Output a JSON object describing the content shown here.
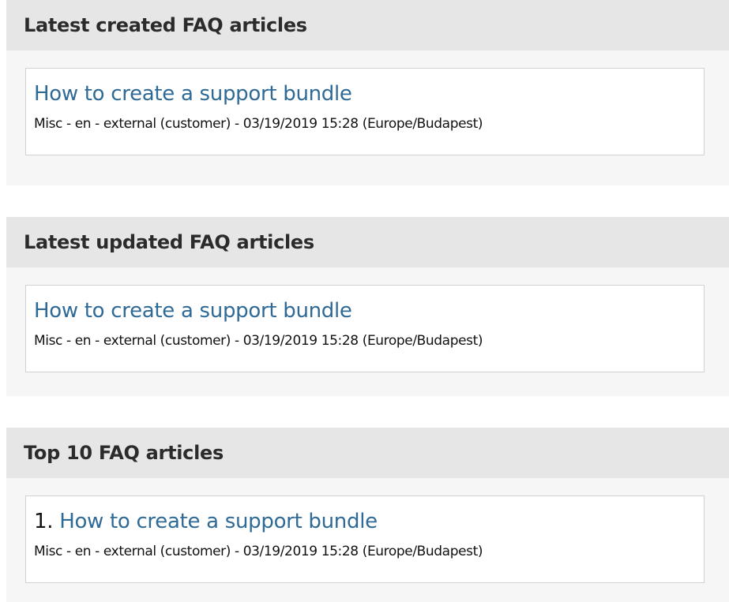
{
  "widgets": [
    {
      "title": "Latest created FAQ articles",
      "articles": [
        {
          "rank": "",
          "title": "How to create a support bundle",
          "meta": "Misc - en - external (customer) - 03/19/2019 15:28 (Europe/Budapest)"
        }
      ]
    },
    {
      "title": "Latest updated FAQ articles",
      "articles": [
        {
          "rank": "",
          "title": "How to create a support bundle",
          "meta": "Misc - en - external (customer) - 03/19/2019 15:28 (Europe/Budapest)"
        }
      ]
    },
    {
      "title": "Top 10 FAQ articles",
      "articles": [
        {
          "rank": "1.",
          "title": "How to create a support bundle",
          "meta": "Misc - en - external (customer) - 03/19/2019 15:28 (Europe/Budapest)"
        }
      ]
    }
  ],
  "colors": {
    "link": "#2f6a96",
    "header_bg": "#e6e6e6",
    "widget_bg": "#f6f6f6",
    "card_border": "#d1d1d1"
  }
}
